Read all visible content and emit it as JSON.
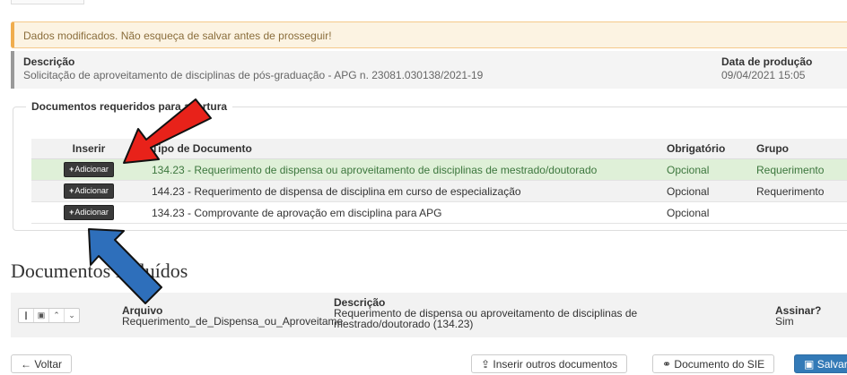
{
  "warning": {
    "text": "Dados modificados. Não esqueça de salvar antes de prosseguir!"
  },
  "description": {
    "label": "Descrição",
    "value": "Solicitação de aproveitamento de disciplinas de pós-graduação - APG n. 23081.030138/2021-19",
    "production_label": "Data de produção",
    "production_value": "09/04/2021 15:05"
  },
  "required_docs": {
    "legend": "Documentos requeridos para abertura",
    "headers": {
      "insert": "Inserir",
      "type": "Tipo de Documento",
      "mandatory": "Obrigatório",
      "group": "Grupo"
    },
    "add_label": "Adicionar",
    "rows": [
      {
        "type": "134.23 - Requerimento de dispensa ou aproveitamento de disciplinas de mestrado/doutorado",
        "mandatory": "Opcional",
        "group": "Requerimento"
      },
      {
        "type": "144.23 - Requerimento de dispensa de disciplina em curso de especialização",
        "mandatory": "Opcional",
        "group": "Requerimento"
      },
      {
        "type": "134.23 - Comprovante de aprovação em disciplina para APG",
        "mandatory": "Opcional",
        "group": ""
      }
    ]
  },
  "included_docs": {
    "title": "Documentos incluídos",
    "headers": {
      "file": "Arquivo",
      "description": "Descrição",
      "sign": "Assinar?"
    },
    "rows": [
      {
        "file": "Requerimento_de_Dispensa_ou_Aproveitame",
        "description_line1": "Requerimento de dispensa ou aproveitamento de disciplinas de",
        "description_line2": "mestrado/doutorado (134.23)",
        "sign": "Sim"
      }
    ]
  },
  "actions": {
    "back": "Voltar",
    "insert_other": "Inserir outros documentos",
    "sie_document": "Documento do SIE",
    "save": "Salvar"
  },
  "icons": [
    "plus-icon",
    "info-icon",
    "trash-icon",
    "chevron-up-icon",
    "chevron-down-icon",
    "arrow-left-icon",
    "upload-icon",
    "link-icon",
    "save-icon"
  ],
  "colors": {
    "warning_bg": "#fcf3e2",
    "highlight_green": "#dff0d8",
    "primary": "#337ab7",
    "red_arrow": "#e8221a",
    "blue_arrow": "#2e6fbb"
  }
}
